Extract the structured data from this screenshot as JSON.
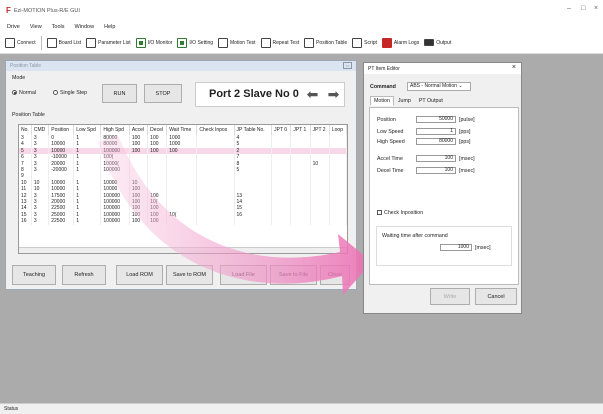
{
  "app": {
    "title": "Ezi-MOTION Plus-R/E GUI"
  },
  "menu": [
    "Drive",
    "View",
    "Tools",
    "Window",
    "Help"
  ],
  "toolbar": [
    {
      "label": "Connect",
      "icon": "connect-icon"
    },
    {
      "label": "Board List",
      "icon": "board-list-icon"
    },
    {
      "label": "Parameter List",
      "icon": "parameter-list-icon"
    },
    {
      "label": "I/O Monitor",
      "icon": "io-monitor-icon"
    },
    {
      "label": "I/O Setting",
      "icon": "io-setting-icon"
    },
    {
      "label": "Motion Test",
      "icon": "motion-test-icon"
    },
    {
      "label": "Repeat Test",
      "icon": "repeat-test-icon"
    },
    {
      "label": "Position Table",
      "icon": "position-table-icon"
    },
    {
      "label": "Script",
      "icon": "script-icon"
    },
    {
      "label": "Alarm Logs",
      "icon": "alarm-logs-icon"
    },
    {
      "label": "Output",
      "icon": "output-icon"
    }
  ],
  "position_window": {
    "title": "Position Table",
    "mode_label": "Mode",
    "mode_normal": "Normal",
    "mode_single": "Single Step",
    "run": "RUN",
    "stop": "STOP",
    "port_label": "Port 2 Slave No 0",
    "section": "Position Table",
    "columns": [
      "No.",
      "CMD",
      "Position",
      "Low Spd",
      "High Spd",
      "Accel",
      "Decel",
      "Wait Time",
      "Check Inpos",
      "JP Table No.",
      "JPT 0",
      "JPT 1",
      "JPT 2",
      "Loop"
    ],
    "rows": [
      [
        "3",
        "3",
        "0",
        "1",
        "80000",
        "100",
        "100",
        "1000",
        "",
        "4",
        "",
        "",
        "",
        ""
      ],
      [
        "4",
        "3",
        "10000",
        "1",
        "80000",
        "100",
        "100",
        "1000",
        "",
        "5",
        "",
        "",
        "",
        ""
      ],
      [
        "5",
        "3",
        "10000",
        "1",
        "100000",
        "100",
        "100",
        "100",
        "",
        "2",
        "",
        "",
        "",
        ""
      ],
      [
        "6",
        "3",
        "-10000",
        "1",
        "100(",
        "",
        "",
        "",
        "",
        "7",
        "",
        "",
        "",
        ""
      ],
      [
        "7",
        "3",
        "20000",
        "1",
        "10000(",
        "",
        "",
        "",
        "",
        "8",
        "",
        "",
        "10",
        ""
      ],
      [
        "8",
        "3",
        "-20000",
        "1",
        "100000",
        "",
        "",
        "",
        "",
        "5",
        "",
        "",
        "",
        ""
      ],
      [
        "9",
        "",
        "",
        "",
        "",
        "",
        "",
        "",
        "",
        "",
        "",
        "",
        "",
        ""
      ],
      [
        "10",
        "10",
        "10000",
        "1",
        "10000",
        "10",
        "",
        "",
        "",
        "",
        "",
        "",
        "",
        ""
      ],
      [
        "11",
        "10",
        "10000",
        "1",
        "10000",
        "100",
        "",
        "",
        "",
        "",
        "",
        "",
        "",
        ""
      ],
      [
        "12",
        "3",
        "17500",
        "1",
        "100000",
        "100",
        "100",
        "",
        "",
        "13",
        "",
        "",
        "",
        ""
      ],
      [
        "13",
        "3",
        "20000",
        "1",
        "100000",
        "100",
        "10(",
        "",
        "",
        "14",
        "",
        "",
        "",
        ""
      ],
      [
        "14",
        "3",
        "22500",
        "1",
        "100000",
        "100",
        "100",
        "",
        "",
        "15",
        "",
        "",
        "",
        ""
      ],
      [
        "15",
        "3",
        "25000",
        "1",
        "100000",
        "100",
        "100",
        "10(",
        "",
        "16",
        "",
        "",
        "",
        ""
      ],
      [
        "16",
        "3",
        "22500",
        "1",
        "100000",
        "100",
        "100",
        "",
        "",
        "",
        "",
        "",
        "",
        ""
      ]
    ],
    "buttons": [
      "Teaching",
      "Refresh",
      "Load ROM",
      "Save to ROM",
      "Load File",
      "Save to File",
      "Close"
    ]
  },
  "editor": {
    "title": "PT Item Editor",
    "command_label": "Command",
    "command_value": "ABS - Normal Motion",
    "tabs": [
      "Motion",
      "Jump",
      "PT Output"
    ],
    "position_label": "Position",
    "position_value": "50000",
    "position_unit": "[pulse]",
    "low_label": "Low Speed",
    "low_value": "1",
    "low_unit": "[pps]",
    "high_label": "High Speed",
    "high_value": "80000",
    "high_unit": "[pps]",
    "accel_label": "Accel Time",
    "accel_value": "100",
    "accel_unit": "[msec]",
    "decel_label": "Decel Time",
    "decel_value": "100",
    "decel_unit": "[msec]",
    "check_label": "Check Inposition",
    "wait_label": "Waiting time after command",
    "wait_value": "1000",
    "wait_unit": "[msec]",
    "apply": "Write",
    "cancel": "Cancel"
  },
  "status": "Status"
}
